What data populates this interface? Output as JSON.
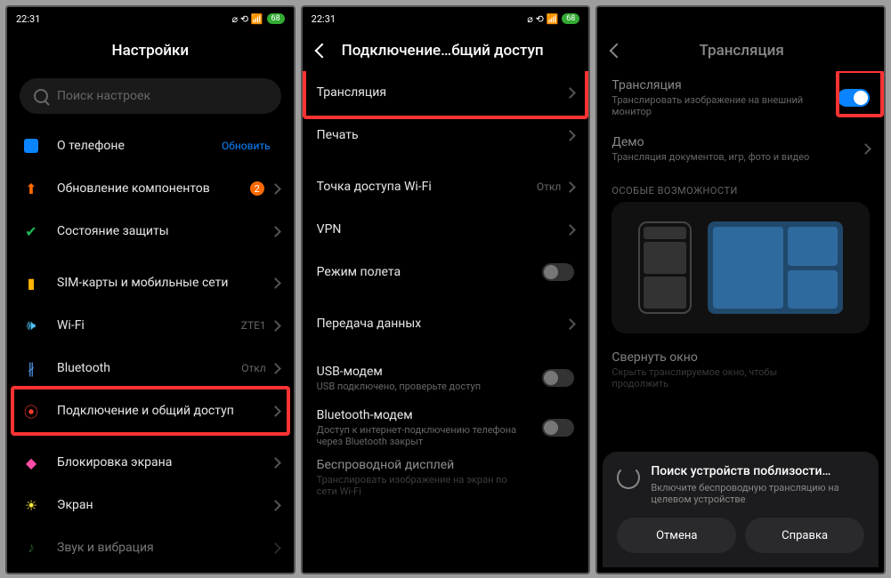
{
  "status": {
    "time": "22:31",
    "icons": "⌀ ⟲ 📶",
    "battery": "68"
  },
  "screen1": {
    "title": "Настройки",
    "search_placeholder": "Поиск настроек",
    "items": [
      {
        "label": "О телефоне",
        "badge_update": "Обновить"
      },
      {
        "label": "Обновление компонентов",
        "badge_count": "2"
      },
      {
        "label": "Состояние защиты"
      },
      {
        "_div": true
      },
      {
        "label": "SIM-карты и мобильные сети"
      },
      {
        "label": "Wi-Fi",
        "trail": "ZTE1"
      },
      {
        "label": "Bluetooth",
        "trail": "Откл"
      },
      {
        "label": "Подключение и общий доступ",
        "hl": true
      },
      {
        "_div": true
      },
      {
        "label": "Блокировка экрана"
      },
      {
        "label": "Экран"
      },
      {
        "label": "Звук и вибрация"
      }
    ]
  },
  "screen2": {
    "title": "Подключение…бщий доступ",
    "items": [
      {
        "label": "Трансляция",
        "hl": true
      },
      {
        "label": "Печать"
      },
      {
        "_div": true
      },
      {
        "label": "Точка доступа Wi-Fi",
        "trail": "Откл"
      },
      {
        "label": "VPN"
      },
      {
        "label": "Режим полета",
        "toggle": "off"
      },
      {
        "_div": true
      },
      {
        "label": "Передача данных"
      },
      {
        "_div": true
      },
      {
        "label": "USB-модем",
        "sub": "USB подключено, проверьте доступ",
        "toggle": "off"
      },
      {
        "label": "Bluetooth-модем",
        "sub": "Доступ к интернет-подключению телефона через Bluetooth закрыт",
        "toggle": "off"
      },
      {
        "label": "Беспроводной дисплей",
        "sub": "Транслировать изображение на экран по сети Wi-Fi"
      }
    ]
  },
  "screen3": {
    "title": "Трансляция",
    "cast": {
      "label": "Трансляция",
      "sub": "Транслировать изображение на внешний монитор",
      "hl_toggle": true
    },
    "demo": {
      "label": "Демо",
      "sub": "Трансляция документов, игр, фото и видео"
    },
    "section": "ОСОБЫЕ ВОЗМОЖНОСТИ",
    "minimize": {
      "label": "Свернуть окно",
      "sub": "Скрыть транслируемое окно, чтобы продолжить"
    },
    "popup": {
      "title": "Поиск устройств поблизости…",
      "sub": "Включите беспроводную трансляцию на целевом устройстве",
      "cancel": "Отмена",
      "help": "Справка"
    }
  }
}
